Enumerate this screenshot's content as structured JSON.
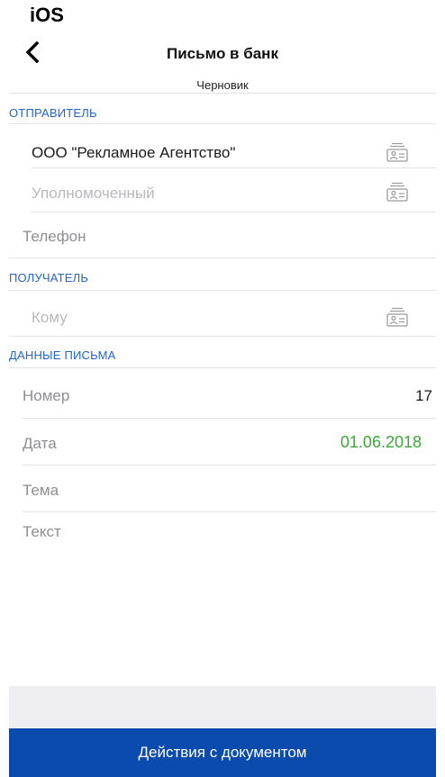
{
  "platform_label": "iOS",
  "header": {
    "title": "Письмо в банк",
    "status": "Черновик"
  },
  "sections": {
    "sender": {
      "title": "ОТПРАВИТЕЛЬ",
      "organization": "ООО \"Рекламное Агентство\"",
      "authorized_placeholder": "Уполномоченный",
      "phone_label": "Телефон"
    },
    "recipient": {
      "title": "ПОЛУЧАТЕЛЬ",
      "to_placeholder": "Кому"
    },
    "letter": {
      "title": "ДАННЫЕ ПИСЬМА",
      "number_label": "Номер",
      "number_value": "17",
      "date_label": "Дата",
      "date_value": "01.06.2018",
      "subject_label": "Тема",
      "text_label": "Текст"
    }
  },
  "actions": {
    "document_actions_label": "Действия с документом"
  },
  "colors": {
    "accent_blue": "#2264c8",
    "action_bar": "#0a4bad",
    "date_green": "#3aa935"
  },
  "icons": {
    "back": "chevron-left-icon",
    "contact": "contact-card-icon"
  }
}
